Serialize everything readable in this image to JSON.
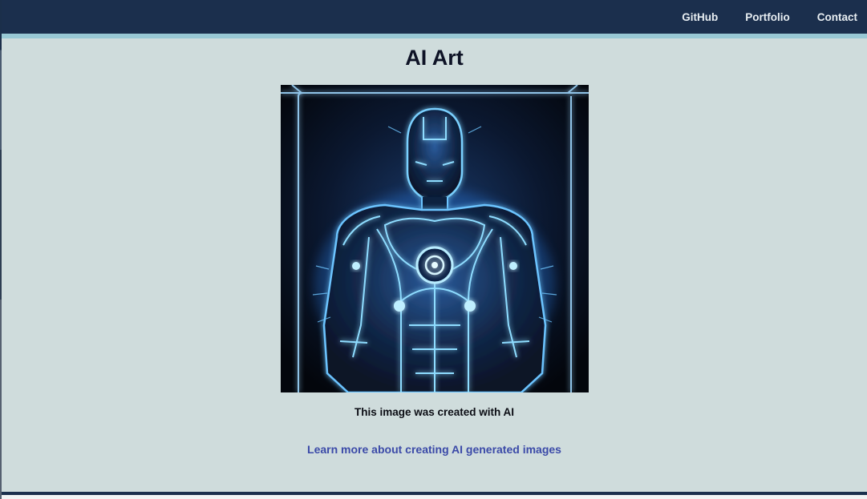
{
  "nav": {
    "links": [
      {
        "label": "GitHub"
      },
      {
        "label": "Portfolio"
      },
      {
        "label": "Contact"
      }
    ]
  },
  "main": {
    "title": "AI Art",
    "image_subject": "glowing blue neon humanoid robot",
    "caption": "This image was created with AI",
    "learn_more_link": "Learn more about creating AI generated images"
  },
  "colors": {
    "nav_background": "#1b2f4d",
    "nav_accent_stripe": "#98c8d4",
    "page_background": "#cfdcdc",
    "link": "#3b4aa8",
    "neon_glow": "#4fb8ff"
  }
}
